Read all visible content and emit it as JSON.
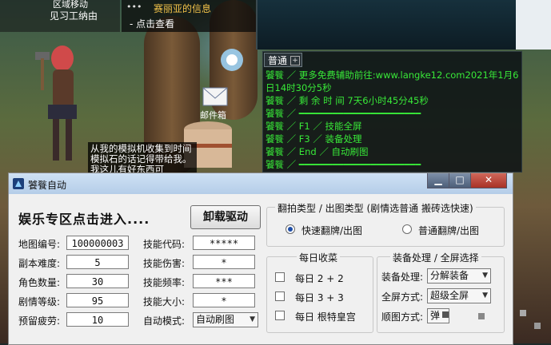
{
  "game": {
    "top_left_line1": "区域移动",
    "top_left_line2": "见习工纳由",
    "news_dots": "•••",
    "news_title": "赛丽亚的信息",
    "news_link": "- 点击查看",
    "chat_tab": "普通",
    "chat_plus": "+",
    "chat_lines": [
      "饕餮 ／ 更多免费辅助前往:www.langke12.com2021年1月6",
      "         日14时30分5秒",
      "饕餮 ／  剩 余 时 间 7天6小时45分45秒",
      "饕餮 ／ ━━━━━━━━━━━━━━━━━━━━━━",
      "饕餮 ／   F1  ／ 技能全屏",
      "饕餮 ／   F3  ／ 装备处理",
      "饕餮 ／   End  ／ 自动刷图",
      "饕餮 ／ ━━━━━━━━━━━━━━━━━━━━━━"
    ],
    "speech": "从我的模拟机收集到时间模拟石的话记得带给我。我这儿有好东西可",
    "mail_label": "邮件箱"
  },
  "window": {
    "title": "饕餮自动",
    "min": "▁",
    "max": "□",
    "close": "✕",
    "promo": "娱乐专区点击进入....",
    "unload_button": "卸载驱动"
  },
  "left_fields": [
    {
      "label": "地图编号:",
      "value": "100000003"
    },
    {
      "label": "副本难度:",
      "value": "5"
    },
    {
      "label": "角色数量:",
      "value": "30"
    },
    {
      "label": "剧情等级:",
      "value": "95"
    },
    {
      "label": "预留疲劳:",
      "value": "10"
    }
  ],
  "skill_fields": [
    {
      "label": "技能代码:",
      "value": "*****"
    },
    {
      "label": "技能伤害:",
      "value": "*"
    },
    {
      "label": "技能频率:",
      "value": "***"
    },
    {
      "label": "技能大小:",
      "value": "*"
    }
  ],
  "auto_mode": {
    "label": "自动模式:",
    "value": "自动刷图"
  },
  "flip_group": {
    "title": "翻拍类型 / 出图类型 (剧情选普通 搬砖选快速)",
    "option1": "快速翻牌/出图",
    "option2": "普通翻牌/出图",
    "selected": 1
  },
  "daily_group": {
    "title": "每日收菜",
    "items": [
      "每日 2 + 2",
      "每日 3 + 3",
      "每日 根特皇宫"
    ]
  },
  "equip_group": {
    "title": "装备处理 / 全屏选择",
    "equip": {
      "label": "装备处理:",
      "value": "分解装备"
    },
    "fullscreen": {
      "label": "全屏方式:",
      "value": "超级全屏"
    },
    "order": {
      "label": "顺图方式:",
      "value": "弹"
    }
  },
  "colors": {
    "chat_green": "#38e838",
    "titlebar": "#b5cde8",
    "news_gold": "#f2c34a"
  }
}
